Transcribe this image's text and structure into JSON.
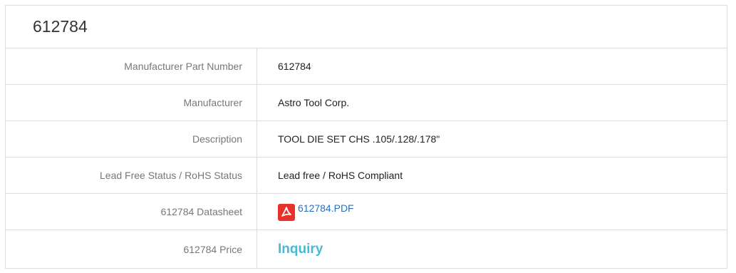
{
  "title": "612784",
  "rows": [
    {
      "label": "Manufacturer Part Number",
      "value": "612784"
    },
    {
      "label": "Manufacturer",
      "value": "Astro Tool Corp."
    },
    {
      "label": "Description",
      "value": "TOOL DIE SET CHS .105/.128/.178\""
    },
    {
      "label": "Lead Free Status / RoHS Status",
      "value": "Lead free / RoHS Compliant"
    },
    {
      "label": "612784 Datasheet",
      "value": "612784.PDF",
      "icon": "pdf-icon"
    },
    {
      "label": "612784 Price",
      "value": "Inquiry"
    }
  ],
  "colors": {
    "link": "#2a6ebb",
    "inquiry": "#4ab8d8",
    "pdf_icon": "#e8312a"
  }
}
